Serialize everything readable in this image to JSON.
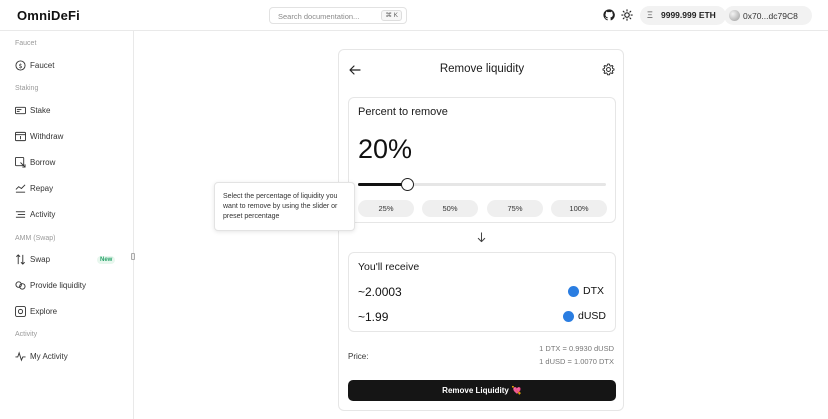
{
  "header": {
    "logo": "OmniDeFi",
    "search_placeholder": "Search documentation...",
    "search_shortcut": "⌘ K",
    "eth_symbol": "Ξ",
    "eth_balance": "9999.999 ETH",
    "wallet_address": "0x70...dc79C8",
    "icons": [
      "github-icon",
      "sun-icon"
    ]
  },
  "sidebar": {
    "sections": {
      "faucet": "Faucet",
      "staking": "Staking",
      "amm": "AMM (Swap)",
      "activity": "Activity"
    },
    "items": {
      "faucet": "Faucet",
      "stake": "Stake",
      "withdraw": "Withdraw",
      "borrow": "Borrow",
      "repay": "Repay",
      "activity": "Activity",
      "swap": "Swap",
      "provide_liquidity": "Provide liquidity",
      "explore": "Explore",
      "my_activity": "My Activity"
    },
    "swap_badge": "New"
  },
  "card": {
    "title": "Remove liquidity",
    "percent_title": "Percent to remove",
    "percent_value": "20%",
    "slider_fraction": 0.2,
    "presets": [
      "25%",
      "50%",
      "75%",
      "100%"
    ],
    "receive_title": "You'll receive",
    "receive": [
      {
        "amount": "~2.0003",
        "token": "DTX"
      },
      {
        "amount": "~1.99",
        "token": "dUSD"
      }
    ],
    "price_label": "Price:",
    "price_lines": [
      "1 DTX = 0.9930 dUSD",
      "1 dUSD = 1.0070 DTX"
    ],
    "submit_label": "Remove Liquidity",
    "submit_emoji": "💘"
  },
  "tooltip": {
    "text": "Select the percentage of liquidity you want to remove by using the slider or preset percentage"
  },
  "colors": {
    "accent": "#151515",
    "token": "#2a7de1",
    "badge_text": "#26a269"
  }
}
